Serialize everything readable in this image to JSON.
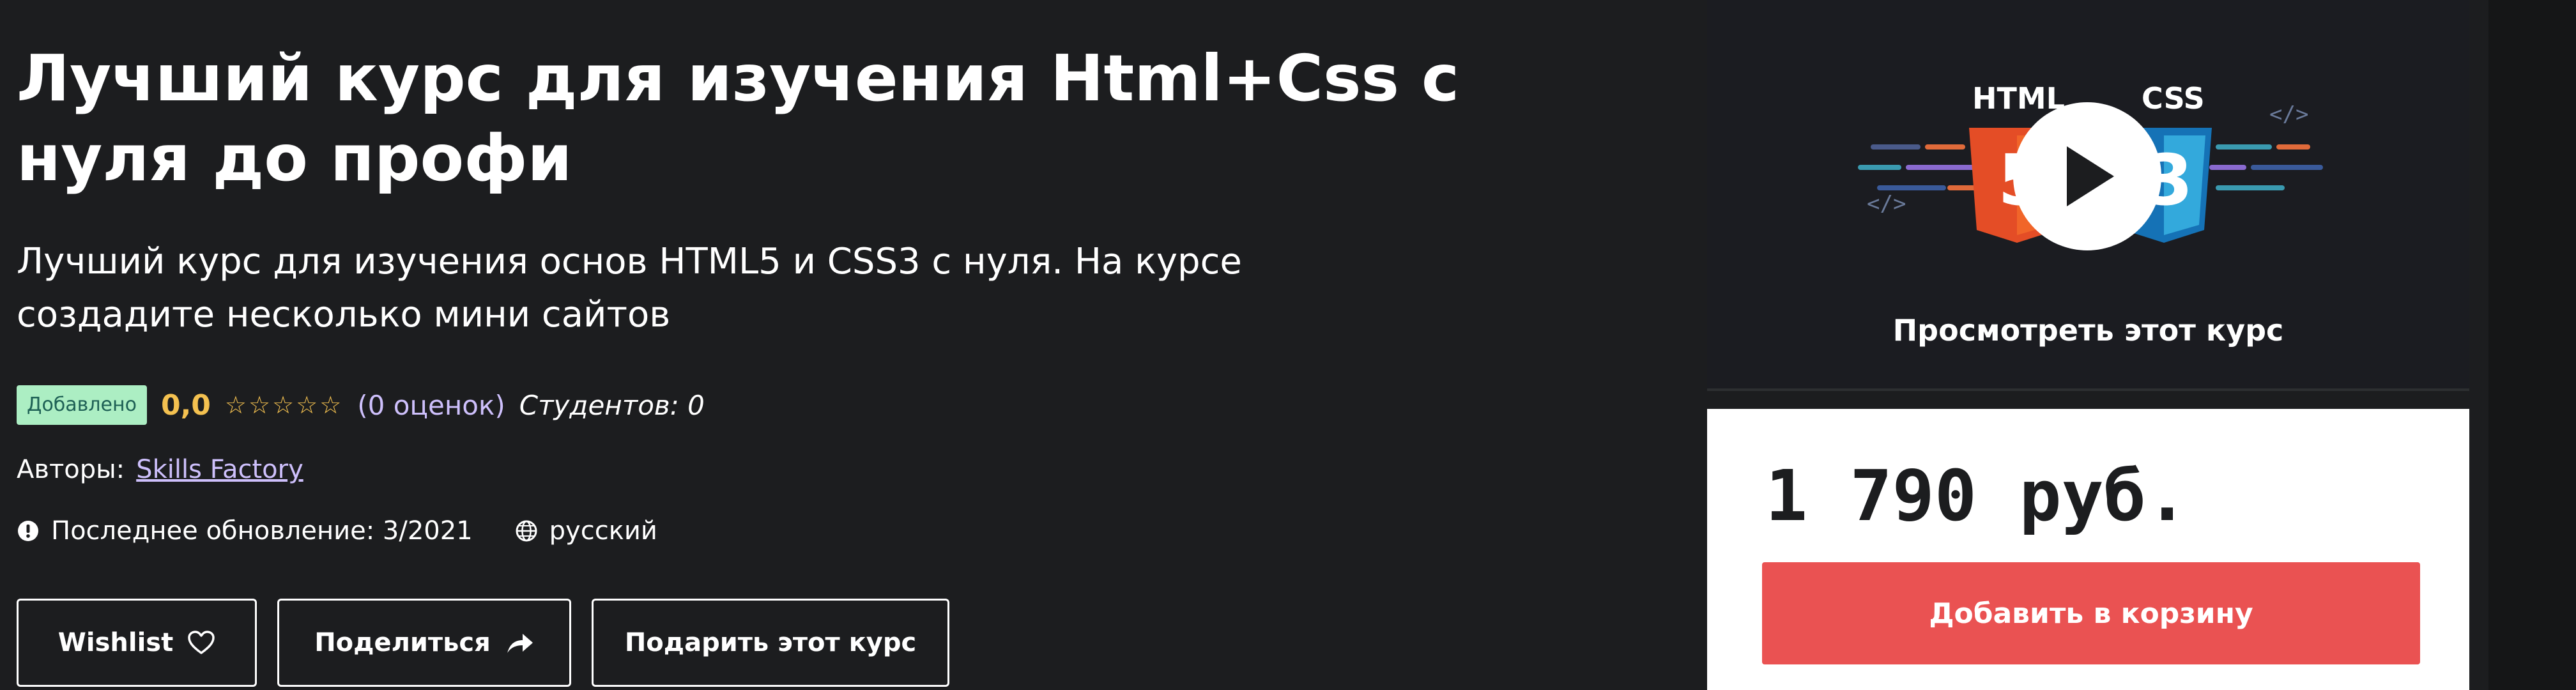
{
  "course": {
    "title": "Лучший курс для изучения Html+Css с нуля до профи",
    "subtitle": "Лучший курс для изучения основ HTML5 и CSS3 с нуля. На курсе создадите несколько мини сайтов",
    "badge": "Добавлено",
    "rating_value": "0,0",
    "stars": "☆☆☆☆☆",
    "ratings_count": "(0 оценок)",
    "students": "Студентов: 0",
    "authors_label": "Авторы:",
    "author_name": "Skills Factory",
    "last_update": "Последнее обновление: 3/2021",
    "language": "русский"
  },
  "actions": {
    "wishlist": "Wishlist",
    "share": "Поделиться",
    "gift": "Подарить этот курс"
  },
  "preview": {
    "label": "Просмотреть этот курс",
    "html_text": "HTML",
    "css_text": "CSS"
  },
  "purchase": {
    "price": "1 790 руб.",
    "add_to_cart": "Добавить в корзину"
  },
  "colors": {
    "background": "#1c1d1f",
    "badge_bg": "#aceec3",
    "rating": "#f4c150",
    "link": "#cec0fc",
    "cart_button": "#ea5252"
  }
}
